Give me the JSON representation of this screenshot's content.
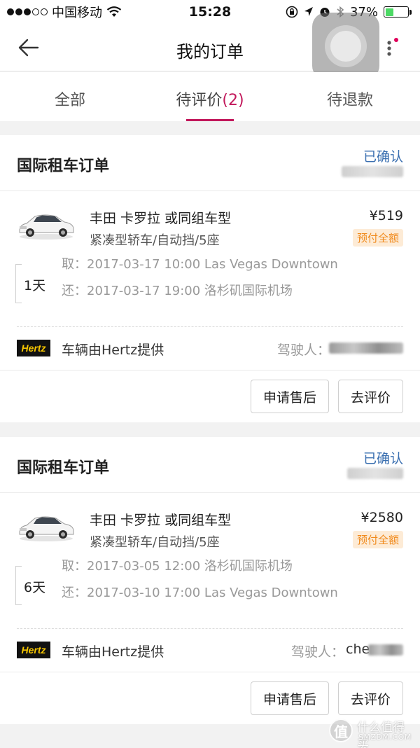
{
  "status_bar": {
    "carrier": "中国移动",
    "time": "15:28",
    "battery": "37%",
    "battery_level": 0.37,
    "icons": [
      "signal-dots-icon",
      "wifi-icon",
      "orientation-lock-icon",
      "location-arrow-icon",
      "alarm-icon",
      "bluetooth-icon",
      "battery-icon"
    ]
  },
  "nav": {
    "title": "我的订单",
    "back_icon": "arrow-left-icon",
    "more_icon": "more-vertical-icon"
  },
  "tabs": [
    {
      "label": "全部",
      "count": "",
      "active": false
    },
    {
      "label": "待评价",
      "count": "(2)",
      "active": true
    },
    {
      "label": "待退款",
      "count": "",
      "active": false
    }
  ],
  "orders": [
    {
      "title": "国际租车订单",
      "status": "已确认",
      "car_name": "丰田 卡罗拉 或同组车型",
      "car_spec": "紧凑型轿车/自动挡/5座",
      "price": "¥519",
      "prepay": "预付全额",
      "days": "1天",
      "pickup_label": "取：",
      "pickup": "2017-03-17 10:00 Las Vegas Downtown",
      "return_label": "还：",
      "return": "2017-03-17 19:00 洛杉矶国际机场",
      "provider_logo": "Hertz",
      "provider": "车辆由Hertz提供",
      "driver_label": "驾驶人：",
      "after_sale_button": "申请售后",
      "review_button": "去评价"
    },
    {
      "title": "国际租车订单",
      "status": "已确认",
      "car_name": "丰田 卡罗拉 或同组车型",
      "car_spec": "紧凑型轿车/自动挡/5座",
      "price": "¥2580",
      "prepay": "预付全额",
      "days": "6天",
      "pickup_label": "取：",
      "pickup": "2017-03-05 12:00 洛杉矶国际机场",
      "return_label": "还：",
      "return": "2017-03-10 17:00 Las Vegas Downtown",
      "provider_logo": "Hertz",
      "provider": "车辆由Hertz提供",
      "driver_label": "驾驶人：",
      "driver_partial": "che",
      "after_sale_button": "申请售后",
      "review_button": "去评价"
    }
  ],
  "watermark": {
    "glyph": "值",
    "text": "什么值得买",
    "sub": "SMZDM.COM"
  },
  "colors": {
    "accent": "#c2185b",
    "status_blue": "#3a6fb0",
    "prepay_orange": "#f08a1c",
    "battery_green": "#4cd964"
  }
}
